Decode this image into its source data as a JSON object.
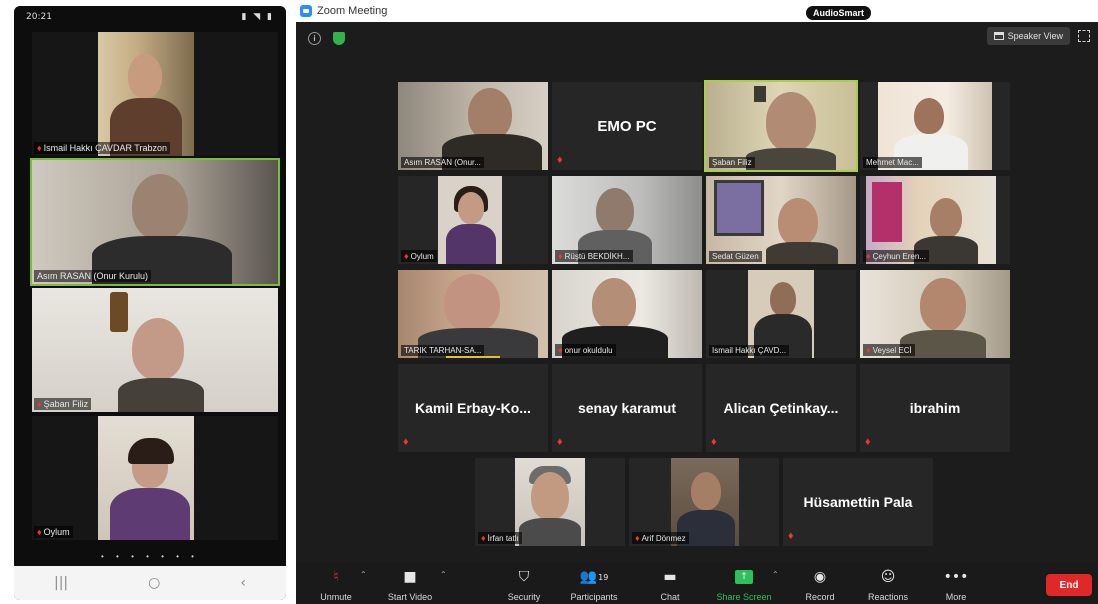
{
  "phone": {
    "status_time": "20:21",
    "tiles": [
      {
        "label": "Ismail Hakkı ÇAVDAR Trabzon",
        "muted": true
      },
      {
        "label": "Asım RASAN (Onur Kurulu)",
        "muted": false
      },
      {
        "label": "Şaban Filiz",
        "muted": true
      },
      {
        "label": "Oylum",
        "muted": true
      }
    ],
    "page_dots": "• • • • • • •",
    "nav": {
      "recent": "|||",
      "home": "○",
      "back": "‹"
    }
  },
  "desktop": {
    "window_title": "Zoom Meeting",
    "audio_badge": "AudioSmart",
    "speaker_view_label": "Speaker View",
    "tiles": [
      {
        "name": "Asım RASAN (Onur...",
        "type": "video",
        "muted": false
      },
      {
        "name": "EMO PC",
        "type": "text",
        "muted": true
      },
      {
        "name": "Şaban Filiz",
        "type": "video",
        "muted": false,
        "speaking": true
      },
      {
        "name": "Mehmet Mac...",
        "type": "video",
        "muted": false
      },
      {
        "name": "Oylum",
        "type": "video",
        "muted": true
      },
      {
        "name": "Rüştü BEKDİKH...",
        "type": "video",
        "muted": true
      },
      {
        "name": "Sedat Güzen",
        "type": "video",
        "muted": false
      },
      {
        "name": "Çeyhun Eren...",
        "type": "video",
        "muted": true
      },
      {
        "name": "TARIK TARHAN-SA...",
        "type": "video",
        "muted": false
      },
      {
        "name": "onur okuldulu",
        "type": "video",
        "muted": true
      },
      {
        "name": "Ismail Hakkı ÇAVD...",
        "type": "video",
        "muted": false
      },
      {
        "name": "Veysel ECİ",
        "type": "video",
        "muted": true
      },
      {
        "name": "Kamil Erbay-Ko...",
        "type": "text",
        "muted": true
      },
      {
        "name": "senay karamut",
        "type": "text",
        "muted": true
      },
      {
        "name": "Alican Çetinkay...",
        "type": "text",
        "muted": true
      },
      {
        "name": "ibrahim",
        "type": "text",
        "muted": true
      },
      {
        "name": "İrfan tatlı",
        "type": "video",
        "muted": true
      },
      {
        "name": "Arif Dönmez",
        "type": "video",
        "muted": true
      },
      {
        "name": "Hüsamettin Pala",
        "type": "text",
        "muted": true
      }
    ],
    "toolbar": {
      "unmute": "Unmute",
      "start_video": "Start Video",
      "security": "Security",
      "participants": "Participants",
      "participants_count": "19",
      "chat": "Chat",
      "share_screen": "Share Screen",
      "record": "Record",
      "reactions": "Reactions",
      "more": "More",
      "end": "End"
    }
  },
  "colors": {
    "speaking_outline": "#a8cf45",
    "share_green": "#2fc05c",
    "end_red": "#e02828",
    "zoom_blue": "#2d8cff"
  }
}
